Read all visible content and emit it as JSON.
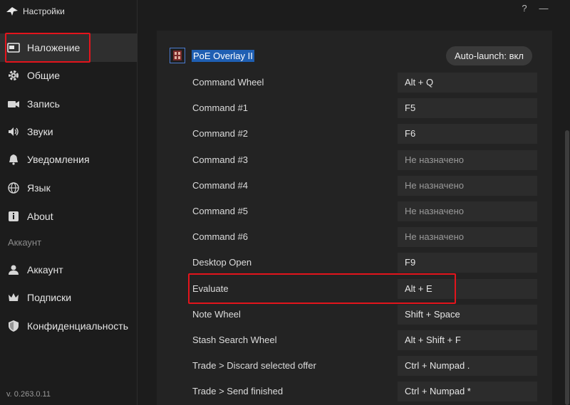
{
  "app": {
    "title": "Настройки"
  },
  "window_controls": {
    "help": "?",
    "minimize": "—"
  },
  "sidebar": {
    "items": [
      {
        "label": "Наложение",
        "icon": "overlay-icon",
        "active": true
      },
      {
        "label": "Общие",
        "icon": "gear-icon"
      },
      {
        "label": "Запись",
        "icon": "camera-icon"
      },
      {
        "label": "Звуки",
        "icon": "speaker-icon"
      },
      {
        "label": "Уведомления",
        "icon": "bell-icon"
      },
      {
        "label": "Язык",
        "icon": "globe-icon"
      },
      {
        "label": "About",
        "icon": "info-icon"
      }
    ],
    "account_section": "Аккаунт",
    "account_items": [
      {
        "label": "Аккаунт",
        "icon": "user-icon"
      },
      {
        "label": "Подписки",
        "icon": "crown-icon"
      },
      {
        "label": "Конфиденциальность",
        "icon": "shield-icon"
      }
    ],
    "version": "v. 0.263.0.11"
  },
  "overlay": {
    "name": "PoE Overlay II",
    "autolaunch_label": "Auto-launch: вкл"
  },
  "hotkeys": [
    {
      "label": "Command Wheel",
      "key": "Alt + Q",
      "unset": false
    },
    {
      "label": "Command #1",
      "key": "F5",
      "unset": false
    },
    {
      "label": "Command #2",
      "key": "F6",
      "unset": false
    },
    {
      "label": "Command #3",
      "key": "Не назначено",
      "unset": true
    },
    {
      "label": "Command #4",
      "key": "Не назначено",
      "unset": true
    },
    {
      "label": "Command #5",
      "key": "Не назначено",
      "unset": true
    },
    {
      "label": "Command #6",
      "key": "Не назначено",
      "unset": true
    },
    {
      "label": "Desktop Open",
      "key": "F9",
      "unset": false
    },
    {
      "label": "Evaluate",
      "key": "Alt + E",
      "unset": false
    },
    {
      "label": "Note Wheel",
      "key": "Shift + Space",
      "unset": false
    },
    {
      "label": "Stash Search Wheel",
      "key": "Alt + Shift + F",
      "unset": false
    },
    {
      "label": "Trade > Discard selected offer",
      "key": "Ctrl + Numpad .",
      "unset": false
    },
    {
      "label": "Trade > Send finished",
      "key": "Ctrl + Numpad *",
      "unset": false
    }
  ]
}
